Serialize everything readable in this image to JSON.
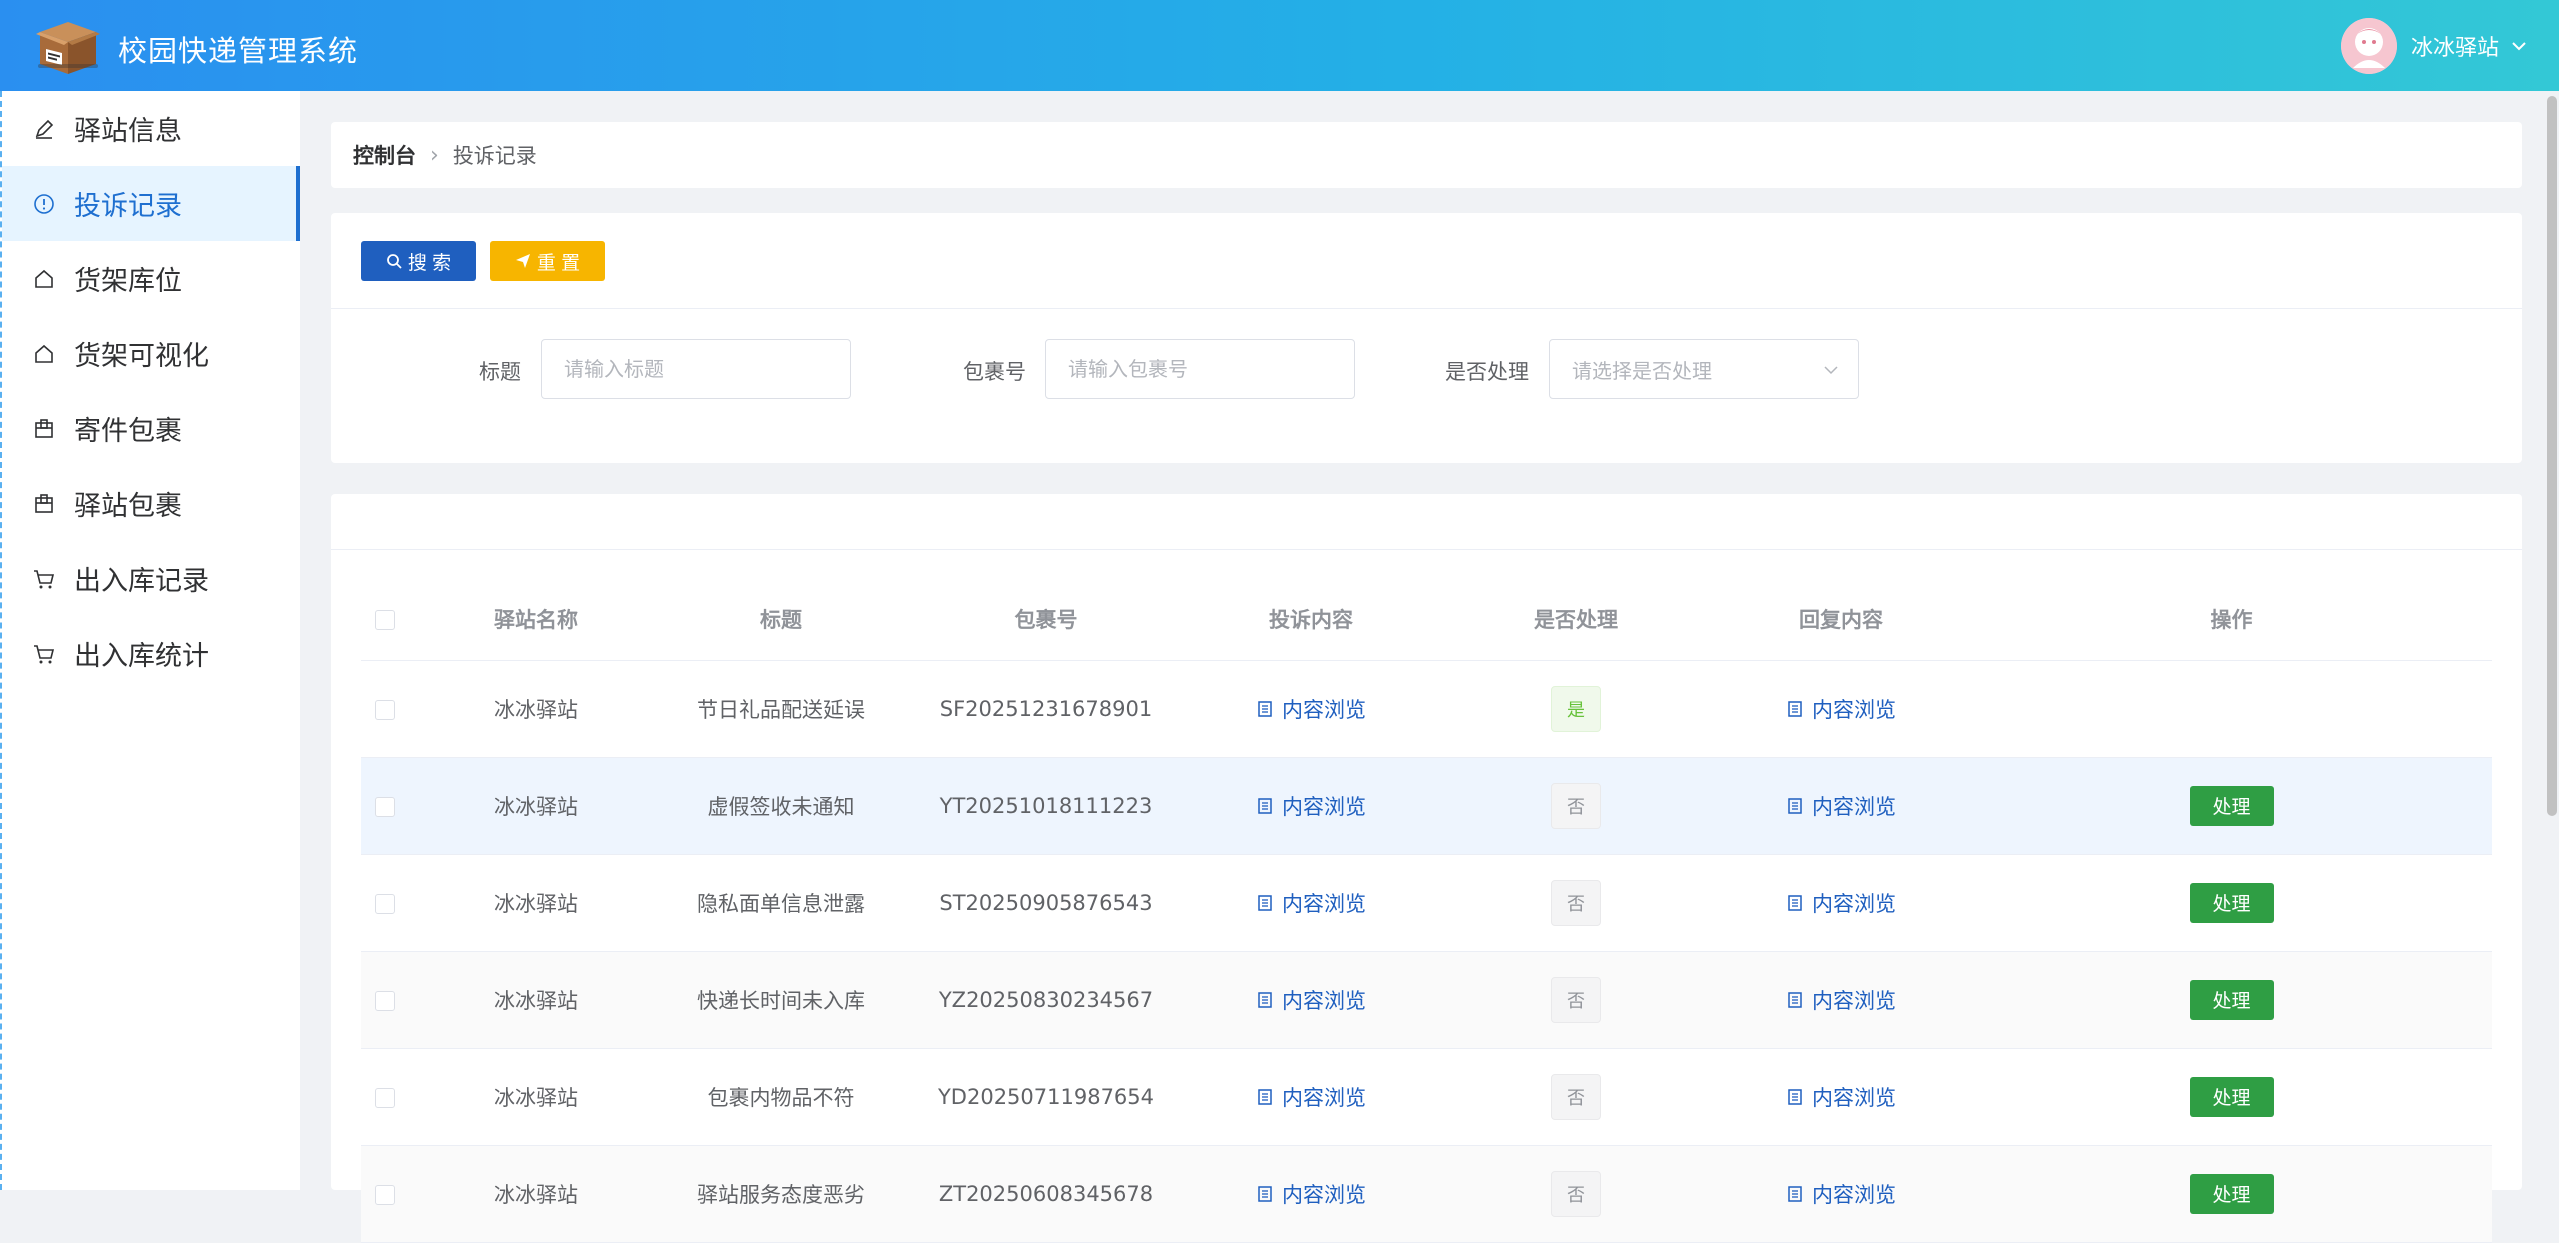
{
  "app": {
    "title": "校园快递管理系统",
    "user_name": "冰冰驿站"
  },
  "sidebar": {
    "items": [
      {
        "label": "驿站信息",
        "icon": "edit-icon"
      },
      {
        "label": "投诉记录",
        "icon": "info-circle-icon",
        "active": true
      },
      {
        "label": "货架库位",
        "icon": "home-icon"
      },
      {
        "label": "货架可视化",
        "icon": "home-icon"
      },
      {
        "label": "寄件包裹",
        "icon": "box-icon"
      },
      {
        "label": "驿站包裹",
        "icon": "box-icon"
      },
      {
        "label": "出入库记录",
        "icon": "cart-icon"
      },
      {
        "label": "出入库统计",
        "icon": "cart-icon"
      }
    ]
  },
  "breadcrumb": {
    "home": "控制台",
    "current": "投诉记录"
  },
  "search": {
    "search_label": "搜 索",
    "reset_label": "重 置",
    "title_label": "标题",
    "title_placeholder": "请输入标题",
    "package_label": "包裹号",
    "package_placeholder": "请输入包裹号",
    "processed_label": "是否处理",
    "processed_placeholder": "请选择是否处理"
  },
  "table": {
    "headers": [
      "驿站名称",
      "标题",
      "包裹号",
      "投诉内容",
      "是否处理",
      "回复内容",
      "操作"
    ],
    "view_label": "内容浏览",
    "process_label": "处理",
    "rows": [
      {
        "station": "冰冰驿站",
        "title": "节日礼品配送延误",
        "package": "SF20251231678901",
        "processed": "是"
      },
      {
        "station": "冰冰驿站",
        "title": "虚假签收未通知",
        "package": "YT20251018111223",
        "processed": "否"
      },
      {
        "station": "冰冰驿站",
        "title": "隐私面单信息泄露",
        "package": "ST20250905876543",
        "processed": "否"
      },
      {
        "station": "冰冰驿站",
        "title": "快递长时间未入库",
        "package": "YZ20250830234567",
        "processed": "否"
      },
      {
        "station": "冰冰驿站",
        "title": "包裹内物品不符",
        "package": "YD20250711987654",
        "processed": "否"
      },
      {
        "station": "冰冰驿站",
        "title": "驿站服务态度恶劣",
        "package": "ZT20250608345678",
        "processed": "否"
      }
    ]
  },
  "colors": {
    "primary": "#1f5fbf",
    "warning": "#f7b500",
    "success": "#2f9e44",
    "header_start": "#2a8ff0",
    "header_end": "#33c8d6"
  }
}
